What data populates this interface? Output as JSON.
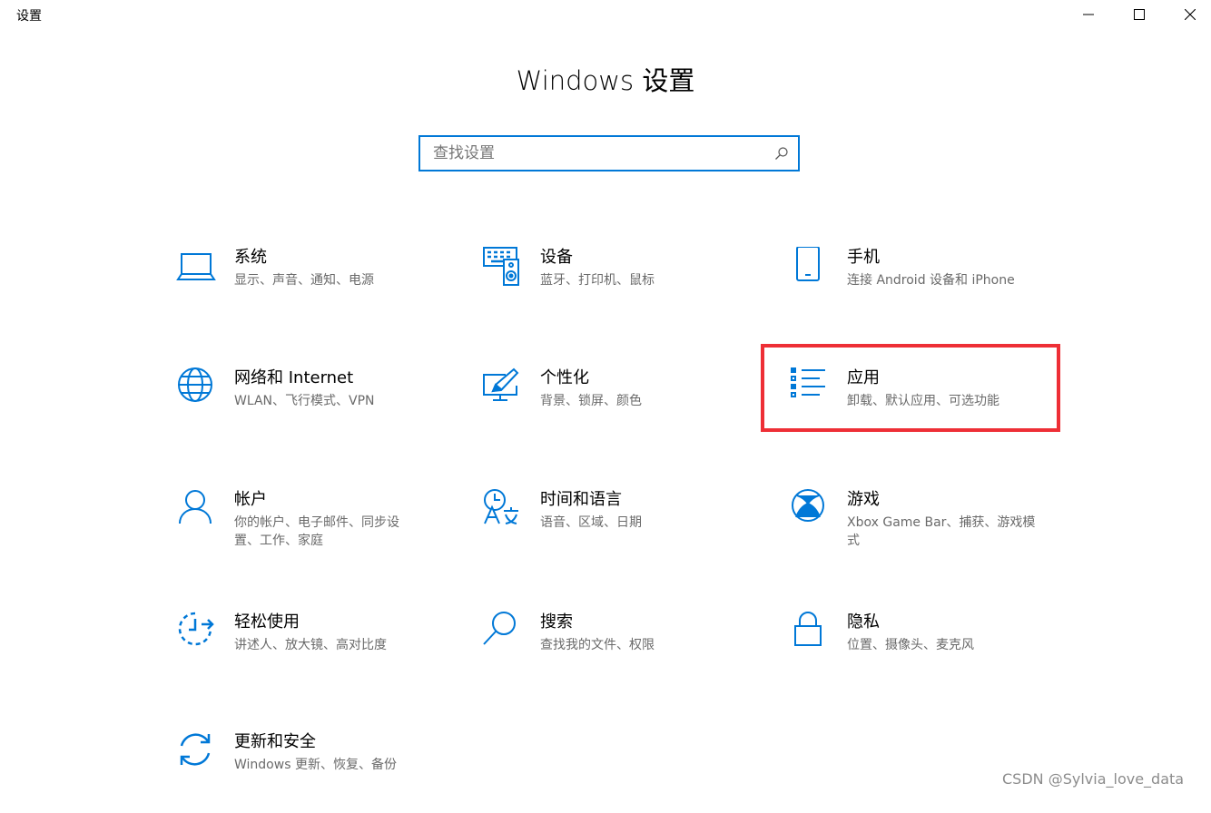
{
  "window": {
    "title": "设置",
    "controls": {
      "minimize": "minimize-icon",
      "maximize": "maximize-icon",
      "close": "close-icon"
    }
  },
  "header": {
    "title": "Windows 设置"
  },
  "search": {
    "placeholder": "查找设置",
    "value": "",
    "icon": "search-icon"
  },
  "accent_color": "#0078d7",
  "highlight_color": "#ee2f36",
  "tiles": [
    {
      "title": "系统",
      "desc": "显示、声音、通知、电源",
      "icon": "laptop-icon"
    },
    {
      "title": "设备",
      "desc": "蓝牙、打印机、鼠标",
      "icon": "devices-icon"
    },
    {
      "title": "手机",
      "desc": "连接 Android 设备和 iPhone",
      "icon": "phone-icon"
    },
    {
      "title": "网络和 Internet",
      "desc": "WLAN、飞行模式、VPN",
      "icon": "globe-icon"
    },
    {
      "title": "个性化",
      "desc": "背景、锁屏、颜色",
      "icon": "personalization-icon"
    },
    {
      "title": "应用",
      "desc": "卸载、默认应用、可选功能",
      "icon": "apps-list-icon",
      "highlighted": true
    },
    {
      "title": "帐户",
      "desc": "你的帐户、电子邮件、同步设置、工作、家庭",
      "icon": "person-icon"
    },
    {
      "title": "时间和语言",
      "desc": "语音、区域、日期",
      "icon": "time-language-icon"
    },
    {
      "title": "游戏",
      "desc": "Xbox Game Bar、捕获、游戏模式",
      "icon": "xbox-icon"
    },
    {
      "title": "轻松使用",
      "desc": "讲述人、放大镜、高对比度",
      "icon": "ease-of-access-icon"
    },
    {
      "title": "搜索",
      "desc": "查找我的文件、权限",
      "icon": "search-magnifier-icon"
    },
    {
      "title": "隐私",
      "desc": "位置、摄像头、麦克风",
      "icon": "lock-icon"
    },
    {
      "title": "更新和安全",
      "desc": "Windows 更新、恢复、备份",
      "icon": "sync-icon"
    }
  ],
  "watermark": "CSDN @Sylvia_love_data"
}
